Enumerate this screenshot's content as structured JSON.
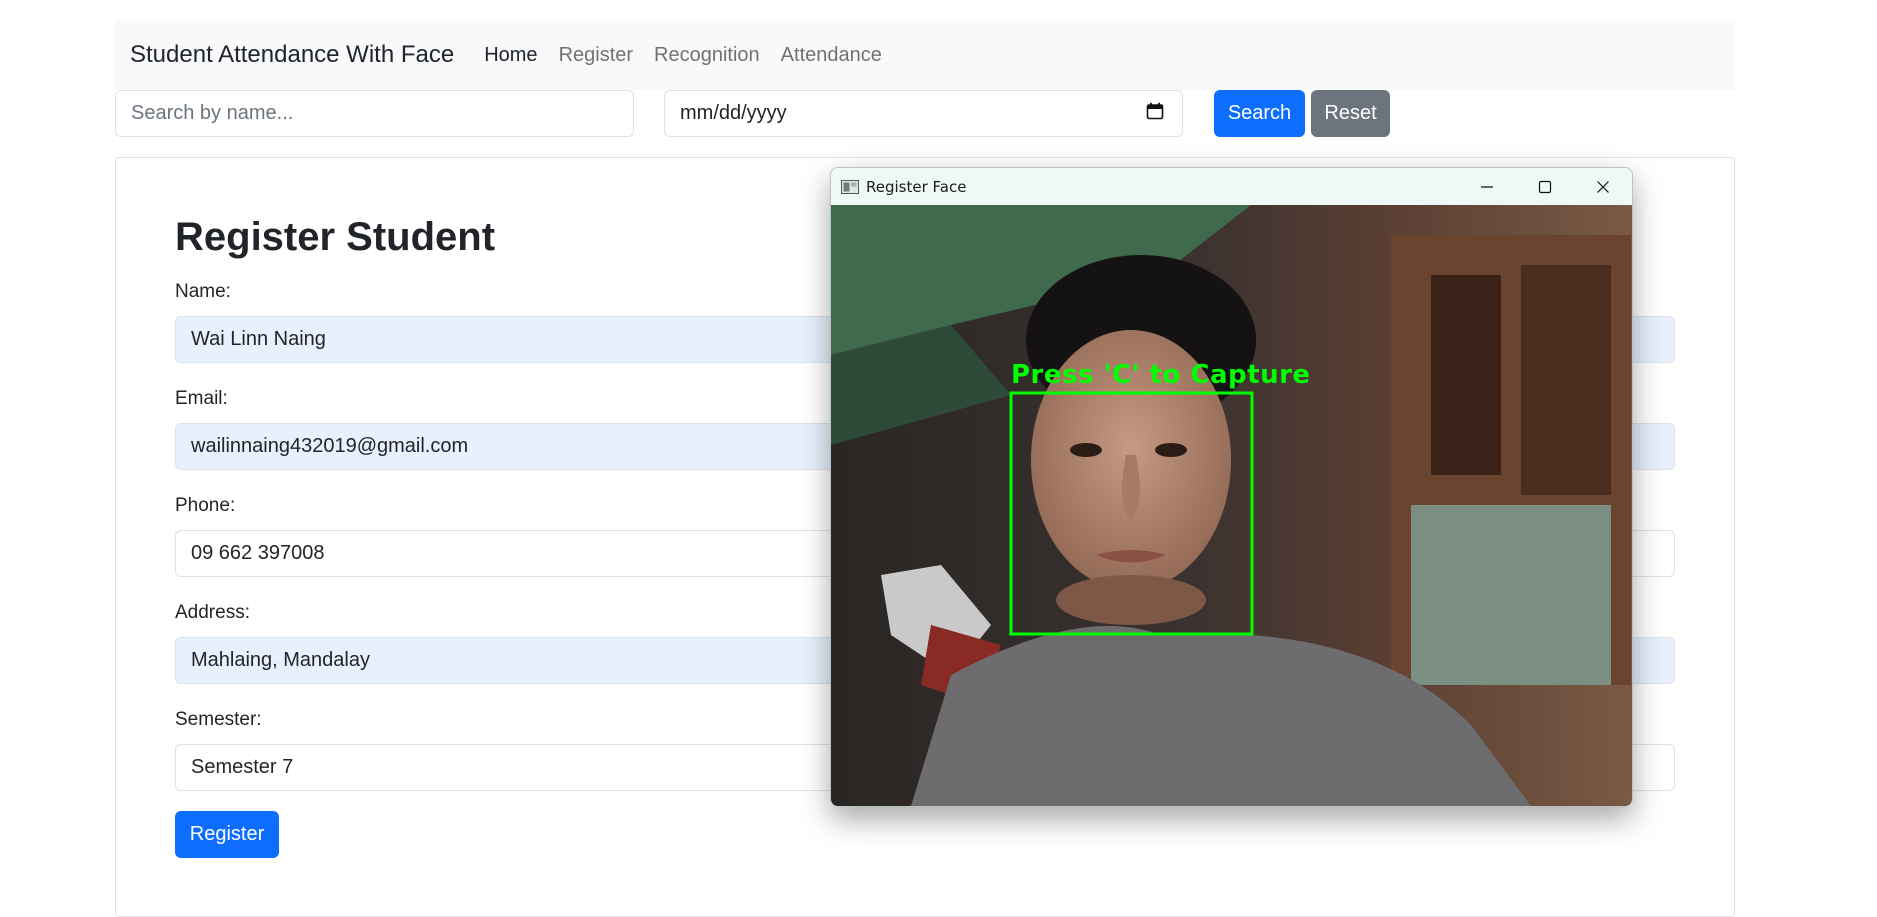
{
  "navbar": {
    "brand": "Student Attendance With Face",
    "links": [
      "Home",
      "Register",
      "Recognition",
      "Attendance"
    ],
    "active": "Home"
  },
  "search": {
    "name_placeholder": "Search by name...",
    "date_placeholder": "mm/dd/yyyy",
    "search_label": "Search",
    "reset_label": "Reset"
  },
  "form": {
    "title": "Register Student",
    "fields": [
      {
        "label": "Name:",
        "value": "Wai Linn Naing"
      },
      {
        "label": "Email:",
        "value": "wailinnaing432019@gmail.com"
      },
      {
        "label": "Phone:",
        "value": "09 662 397008"
      },
      {
        "label": "Address:",
        "value": "Mahlaing, Mandalay"
      },
      {
        "label": "Semester:",
        "value": "Semester 7"
      }
    ],
    "submit_label": "Register"
  },
  "camera_window": {
    "title": "Register Face",
    "overlay_text": "Press 'C' to Capture"
  },
  "colors": {
    "primary": "#0d6efd",
    "secondary": "#6c757d",
    "autofill": "#e8f0fe",
    "face_box": "#00ff00",
    "navbar_bg": "#f8f9fa"
  },
  "icons": [
    "calendar-icon",
    "minimize-icon",
    "maximize-icon",
    "close-icon",
    "window-app-icon"
  ]
}
